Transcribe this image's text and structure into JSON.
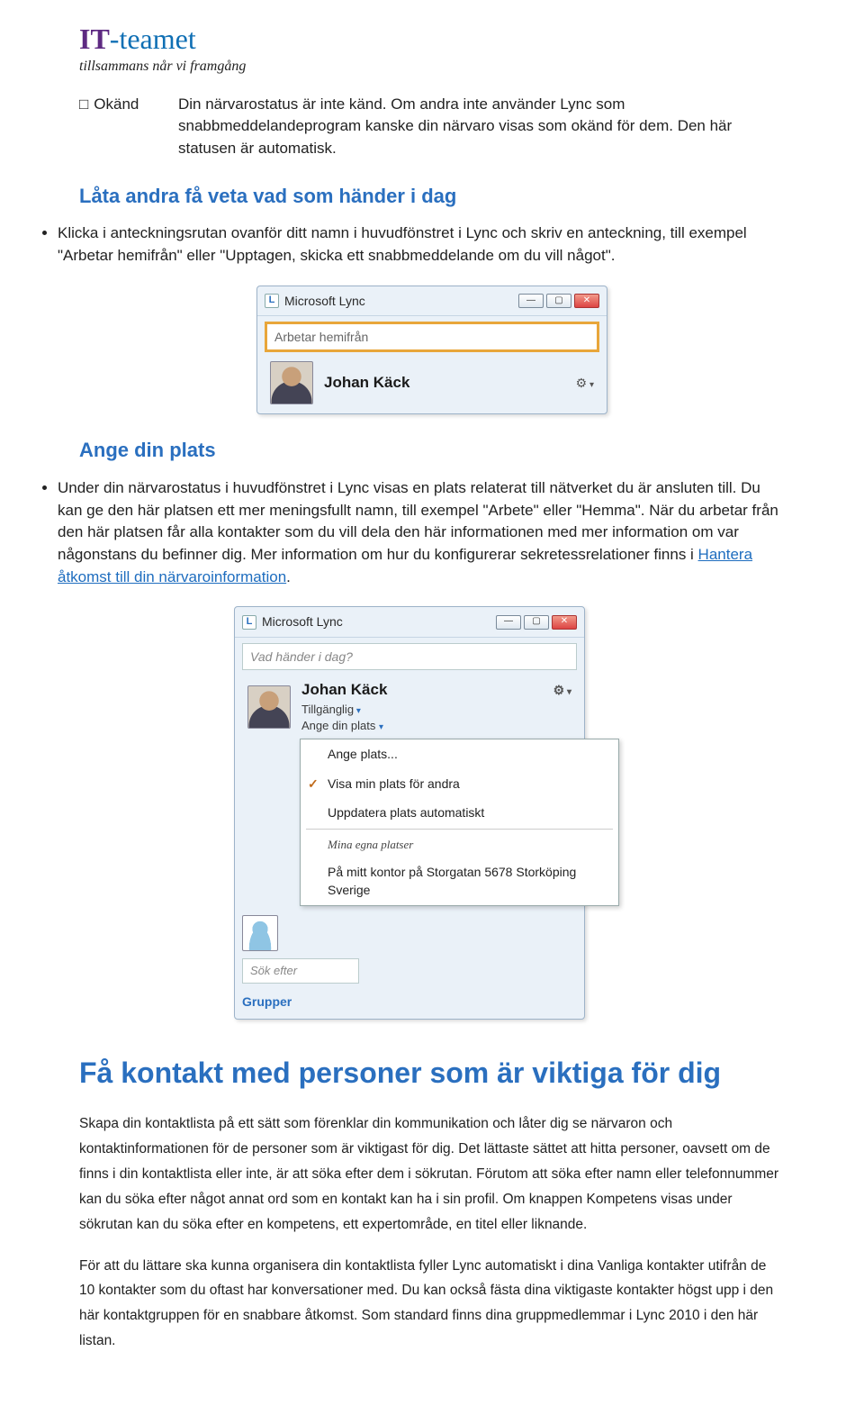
{
  "logo": {
    "it": "IT",
    "team": "-teamet",
    "sub": "tillsammans når vi framgång"
  },
  "status": {
    "label": "Okänd",
    "desc": "Din närvarostatus är inte känd. Om andra inte använder Lync som snabbmeddelandeprogram kanske din närvaro visas som okänd för dem. Den här statusen är automatisk."
  },
  "section1": {
    "title": "Låta andra få veta vad som händer i dag",
    "text": "Klicka i anteckningsrutan ovanför ditt namn i huvudfönstret i Lync och skriv en anteckning, till exempel \"Arbetar hemifrån\" eller \"Upptagen, skicka ett snabbmeddelande om du vill något\"."
  },
  "lync1": {
    "app_title": "Microsoft Lync",
    "note": "Arbetar hemifrån",
    "user": "Johan Käck"
  },
  "section2": {
    "title": "Ange din plats",
    "text_a": "Under din närvarostatus i huvudfönstret i Lync visas en plats relaterat till nätverket du är ansluten till. Du kan ge den här platsen ett mer meningsfullt namn, till exempel \"Arbete\" eller \"Hemma\". När du arbetar från den här platsen får alla kontakter som du vill dela den här informationen med mer information om var någonstans du befinner dig. Mer information om hur du konfigurerar sekretessrelationer finns i ",
    "link": "Hantera åtkomst till din närvaroinformation",
    "text_b": "."
  },
  "lync2": {
    "app_title": "Microsoft Lync",
    "note_placeholder": "Vad händer i dag?",
    "user": "Johan Käck",
    "presence": "Tillgänglig",
    "location_label": "Ange din plats",
    "menu": {
      "set": "Ange plats...",
      "show": "Visa min plats för andra",
      "update": "Uppdatera plats automatiskt",
      "own_head": "Mina egna platser",
      "own_item": "På mitt kontor på Storgatan 5678 Storköping Sverige"
    },
    "search_placeholder": "Sök efter",
    "tab": "Grupper"
  },
  "heading_big": "Få kontakt med personer som är viktiga för dig",
  "para1": "Skapa din kontaktlista på ett sätt som förenklar din kommunikation och låter dig se närvaron och kontaktinformationen för de personer som är viktigast för dig. Det lättaste sättet att hitta personer, oavsett om de finns i din kontaktlista eller inte, är att söka efter dem i sökrutan. Förutom att söka efter namn eller telefonnummer kan du söka efter något annat ord som en kontakt kan ha i sin profil. Om knappen Kompetens visas under sökrutan kan du söka efter en kompetens, ett expertområde, en titel eller liknande.",
  "para2": "För att du lättare ska kunna organisera din kontaktlista fyller Lync automatiskt i dina Vanliga kontakter utifrån de 10 kontakter som du oftast har konversationer med. Du kan också fästa dina viktigaste kontakter högst upp i den här kontaktgruppen för en snabbare åtkomst. Som standard finns dina gruppmedlemmar i Lync 2010 i den här listan.",
  "icons": {
    "L": "L",
    "min": "—",
    "max": "▢",
    "close": "✕",
    "gear": "⚙"
  }
}
